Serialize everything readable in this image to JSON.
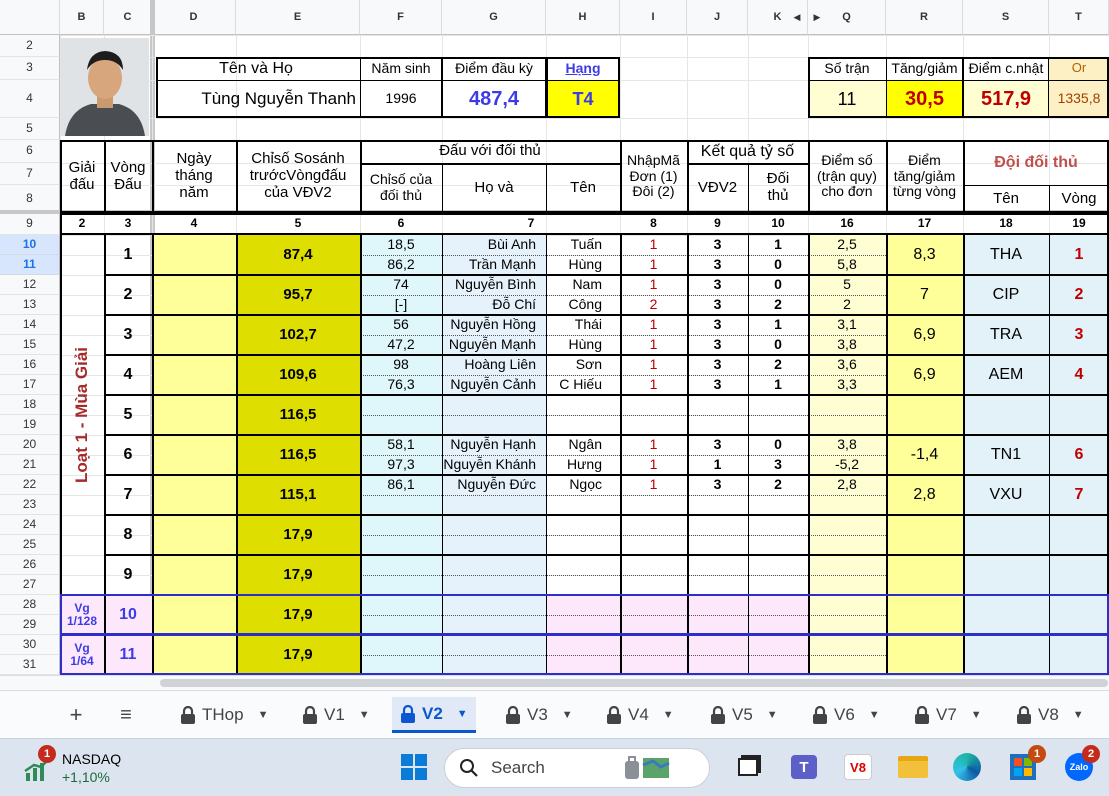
{
  "columns": [
    {
      "id": "B",
      "left": 0
    },
    {
      "id": "C"
    },
    {
      "id": "D"
    },
    {
      "id": "E"
    },
    {
      "id": "F"
    },
    {
      "id": "G"
    },
    {
      "id": "H"
    },
    {
      "id": "I"
    },
    {
      "id": "J"
    },
    {
      "id": "K"
    },
    {
      "id": "Q"
    },
    {
      "id": "R"
    },
    {
      "id": "S"
    },
    {
      "id": "T"
    }
  ],
  "col_ids": [
    "B",
    "C",
    "D",
    "E",
    "F",
    "G",
    "H",
    "I",
    "J",
    "K",
    "Q",
    "R",
    "S",
    "T"
  ],
  "row_ids": [
    "2",
    "3",
    "4",
    "5",
    "6",
    "7",
    "8",
    "9",
    "10",
    "11",
    "12",
    "13",
    "14",
    "15",
    "16",
    "17",
    "18",
    "19",
    "20",
    "21",
    "22",
    "23",
    "24",
    "25",
    "26",
    "27",
    "28",
    "29",
    "30",
    "31"
  ],
  "header": {
    "name_label": "Tên    và    Họ",
    "name_value": "Tùng Nguyễn Thanh",
    "birth_label": "Năm sinh",
    "birth_value": "1996",
    "start_label": "Điểm đầu kỳ",
    "start_value": "487,4",
    "rank_label": "Hạng",
    "rank_value": "T4",
    "matches_label": "Số trận",
    "matches_value": "11",
    "delta_label": "Tăng/giảm",
    "delta_value": "30,5",
    "updated_label": "Điểm c.nhật",
    "updated_value": "517,9",
    "or_label": "Or",
    "or_value": "1335,8"
  },
  "table_head": {
    "giai": "Giải\nđấu",
    "vong": "Vòng\nĐấu",
    "ngay": "Ngày\ntháng\nnăm",
    "chiso": "Chỉsố Sosánh\ntrướcVòngđấu\ncủa VĐV2",
    "dau_voi": "Đấu với đối thủ",
    "chiso_dt": "Chỉsố của\nđối thủ",
    "ho": "Họ    và",
    "ten": "Tên",
    "nhap": "NhậpMã\nĐơn (1)\nĐôi (2)",
    "kq": "Kết quả tỷ số",
    "vdv2": "VĐV2",
    "doithu": "Đối\nthủ",
    "diemso": "Điểm số\n(trận quy)\ncho đơn",
    "tanggiam": "Điểm\ntăng/giảm\ntừng vòng",
    "doi": "Đội đối thủ",
    "doi_ten": "Tên",
    "doi_vong": "Vòng"
  },
  "col_numbers": [
    "2",
    "3",
    "4",
    "5",
    "6",
    "7",
    "8",
    "9",
    "10",
    "16",
    "17",
    "18",
    "19"
  ],
  "season_label": "Loạt 1 - Mùa Giải",
  "rounds": [
    {
      "vong": "1",
      "chiso": "87,4",
      "team": "THA",
      "team_vong": "1",
      "delta": "8,3",
      "games": [
        {
          "cs": "18,5",
          "ho": "Bùi Anh",
          "ten": "Tuấn",
          "code": "1",
          "a": "3",
          "b": "1",
          "pts": "2,5"
        },
        {
          "cs": "86,2",
          "ho": "Trần Mạnh",
          "ten": "Hùng",
          "code": "1",
          "a": "3",
          "b": "0",
          "pts": "5,8"
        }
      ]
    },
    {
      "vong": "2",
      "chiso": "95,7",
      "team": "CIP",
      "team_vong": "2",
      "delta": "7",
      "games": [
        {
          "cs": "74",
          "ho": "Nguyễn Bình",
          "ten": "Nam",
          "code": "1",
          "a": "3",
          "b": "0",
          "pts": "5"
        },
        {
          "cs": "[-]",
          "ho": "Đỗ Chí",
          "ten": "Công",
          "code": "2",
          "a": "3",
          "b": "2",
          "pts": "2"
        }
      ]
    },
    {
      "vong": "3",
      "chiso": "102,7",
      "team": "TRA",
      "team_vong": "3",
      "delta": "6,9",
      "games": [
        {
          "cs": "56",
          "ho": "Nguyễn Hồng",
          "ten": "Thái",
          "code": "1",
          "a": "3",
          "b": "1",
          "pts": "3,1"
        },
        {
          "cs": "47,2",
          "ho": "Nguyễn Mạnh",
          "ten": "Hùng",
          "code": "1",
          "a": "3",
          "b": "0",
          "pts": "3,8"
        }
      ]
    },
    {
      "vong": "4",
      "chiso": "109,6",
      "team": "AEM",
      "team_vong": "4",
      "delta": "6,9",
      "games": [
        {
          "cs": "98",
          "ho": "Hoàng Liên",
          "ten": "Sơn",
          "code": "1",
          "a": "3",
          "b": "2",
          "pts": "3,6"
        },
        {
          "cs": "76,3",
          "ho": "Nguyễn Cảnh",
          "ten": "C Hiếu",
          "code": "1",
          "a": "3",
          "b": "1",
          "pts": "3,3"
        }
      ]
    },
    {
      "vong": "5",
      "chiso": "116,5",
      "team": "",
      "team_vong": "",
      "delta": "",
      "games": [
        {
          "cs": "",
          "ho": "",
          "ten": "",
          "code": "",
          "a": "",
          "b": "",
          "pts": ""
        },
        {
          "cs": "",
          "ho": "",
          "ten": "",
          "code": "",
          "a": "",
          "b": "",
          "pts": ""
        }
      ]
    },
    {
      "vong": "6",
      "chiso": "116,5",
      "team": "TN1",
      "team_vong": "6",
      "delta": "-1,4",
      "games": [
        {
          "cs": "58,1",
          "ho": "Nguyễn Hạnh",
          "ten": "Ngân",
          "code": "1",
          "a": "3",
          "b": "0",
          "pts": "3,8"
        },
        {
          "cs": "97,3",
          "ho": "Nguyễn Khánh",
          "ten": "Hưng",
          "code": "1",
          "a": "1",
          "b": "3",
          "pts": "-5,2"
        }
      ]
    },
    {
      "vong": "7",
      "chiso": "115,1",
      "team": "VXU",
      "team_vong": "7",
      "delta": "2,8",
      "games": [
        {
          "cs": "86,1",
          "ho": "Nguyễn Đức",
          "ten": "Ngọc",
          "code": "1",
          "a": "3",
          "b": "2",
          "pts": "2,8"
        },
        {
          "cs": "",
          "ho": "",
          "ten": "",
          "code": "",
          "a": "",
          "b": "",
          "pts": ""
        }
      ]
    },
    {
      "vong": "8",
      "chiso": "17,9",
      "team": "",
      "team_vong": "",
      "delta": "",
      "games": [
        {},
        {}
      ]
    },
    {
      "vong": "9",
      "chiso": "17,9",
      "team": "",
      "team_vong": "",
      "delta": "",
      "games": [
        {},
        {}
      ]
    },
    {
      "vong": "10",
      "chiso": "17,9",
      "team": "",
      "team_vong": "",
      "delta": "",
      "vg": "Vg\n1/128",
      "games": [
        {},
        {}
      ]
    },
    {
      "vong": "11",
      "chiso": "17,9",
      "team": "",
      "team_vong": "",
      "delta": "",
      "vg": "Vg\n1/64",
      "games": [
        {},
        {}
      ]
    }
  ],
  "tabs": [
    {
      "label": "THop"
    },
    {
      "label": "V1"
    },
    {
      "label": "V2",
      "active": true
    },
    {
      "label": "V3"
    },
    {
      "label": "V4"
    },
    {
      "label": "V5"
    },
    {
      "label": "V6"
    },
    {
      "label": "V7"
    },
    {
      "label": "V8"
    }
  ],
  "taskbar": {
    "stock_name": "NASDAQ",
    "stock_change": "+1,10%",
    "stock_badge": "1",
    "search_placeholder": "Search",
    "store_badge": "1",
    "zalo_badge": "2",
    "zalo_label": "Zalo"
  },
  "colors": {
    "yellow": "#ffff99",
    "olive": "#dede00",
    "cyan": "#dff6fb",
    "pink": "#fde8fb",
    "lightyellow": "#fefed2",
    "red": "#c00000",
    "blue": "#3c3ce6",
    "maroon": "#a52a2a"
  }
}
